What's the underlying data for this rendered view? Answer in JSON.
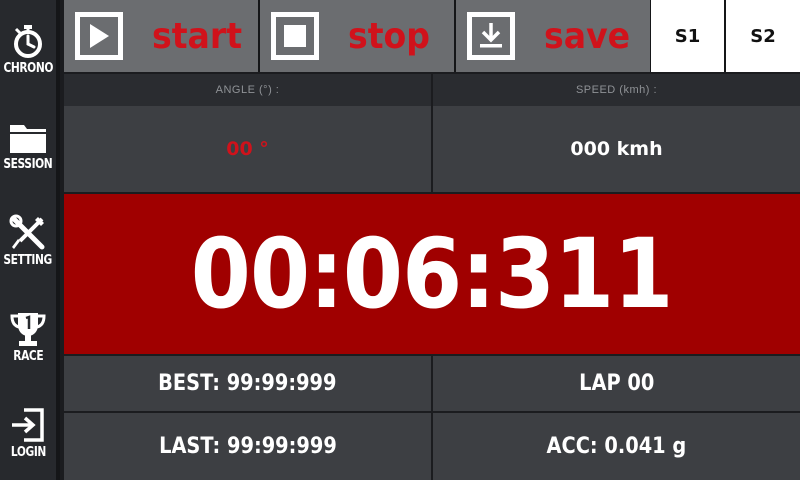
{
  "sidebar": {
    "items": [
      {
        "label": "CHRONO",
        "icon": "stopwatch-icon"
      },
      {
        "label": "SESSION",
        "icon": "folder-icon"
      },
      {
        "label": "SETTING",
        "icon": "wrench-screwdriver-icon"
      },
      {
        "label": "RACE",
        "icon": "trophy-icon"
      },
      {
        "label": "LOGIN",
        "icon": "login-icon"
      }
    ]
  },
  "toolbar": {
    "start_label": "start",
    "stop_label": "stop",
    "save_label": "save",
    "s1_label": "S1",
    "s2_label": "S2"
  },
  "info": {
    "angle_label": "ANGLE (°) :",
    "angle_value": "00 °",
    "speed_label": "SPEED (kmh) :",
    "speed_value": "000 kmh"
  },
  "timer": {
    "value": "00:06:311"
  },
  "stats": {
    "best": "BEST: 99:99:999",
    "lap": "LAP 00",
    "last": "LAST: 99:99:999",
    "acc": "ACC: 0.041 g"
  },
  "colors": {
    "accent_red": "#d0121b",
    "timer_bg": "#a00000",
    "toolbar_button_bg": "#6b6d70",
    "cell_bg": "#3d3f43"
  }
}
